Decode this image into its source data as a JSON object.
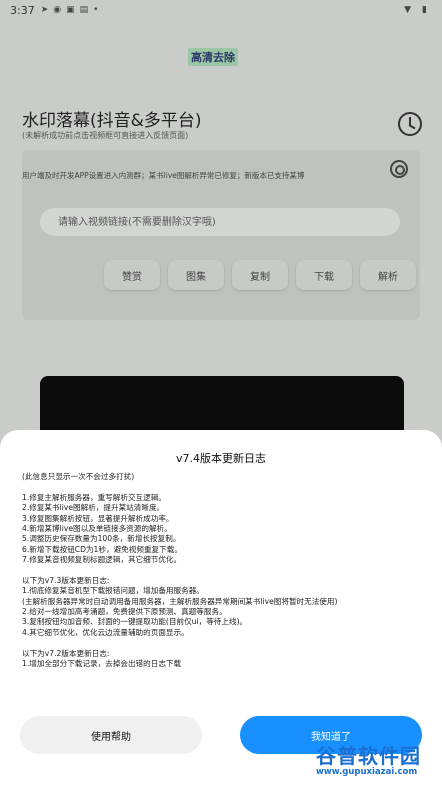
{
  "status_bar": {
    "time": "3:37",
    "icons": [
      "location-icon",
      "telegram-icon",
      "android-icon",
      "app-icon",
      "dot-icon"
    ],
    "right_icons": [
      "wifi-icon",
      "battery-icon"
    ]
  },
  "app": {
    "logo_text": "高清去除",
    "title": "水印落幕(抖音&多平台)",
    "subtitle": "(未解析成功前点击视频框可直接进入反馈页面)",
    "marquee": "用户端及时开发APP设置进入内测群；某书live图解析异常已修复；新版本已支持某博",
    "url_placeholder": "请输入视频链接(不需要删除汉字哦)",
    "buttons": [
      "赞赏",
      "图集",
      "复制",
      "下载",
      "解析"
    ]
  },
  "dialog": {
    "title": "v7.4版本更新日志",
    "lines": [
      "(此信息只显示一次不会过多打扰)",
      "",
      "1.修复主解析服务器，重写解析交互逻辑。",
      "2.修复某书live图解析，提升某站清晰度。",
      "3.修复图集解析按钮，显著提升解析成功率。",
      "4.新增某博live图以及单链接多资源的解析。",
      "5.调整历史保存数量为100条，新增长按复制。",
      "6.新增下载按钮CD为1秒，避免视频重复下载。",
      "7.修复某音视频复制标题逻辑，其它细节优化。",
      "",
      "以下为v7.3版本更新日志:",
      "1.彻底修复某音机型下载报错问题，增加备用服务器。",
      "(主解析服务器异常时自动调用备用服务器，主解析服务器异常期间某书live图将暂时无法使用)",
      "2.给对一线增加高考涌题，免费提供下原预测、真题等服务。",
      "3.复制按钮均加音频、封面的一键提取功能(目前仅ui，等待上线)。",
      "4.其它细节优化，优化云边流量辅助的页面显示。",
      "",
      "以下为v7.2版本更新日志:",
      "1.增加全部分下载记录，去掉会出错的日志下载"
    ],
    "help_label": "使用帮助",
    "ok_label": "我知道了"
  },
  "watermark": {
    "top": "谷普软件园",
    "bottom": "www.gupuxiazai.com"
  }
}
